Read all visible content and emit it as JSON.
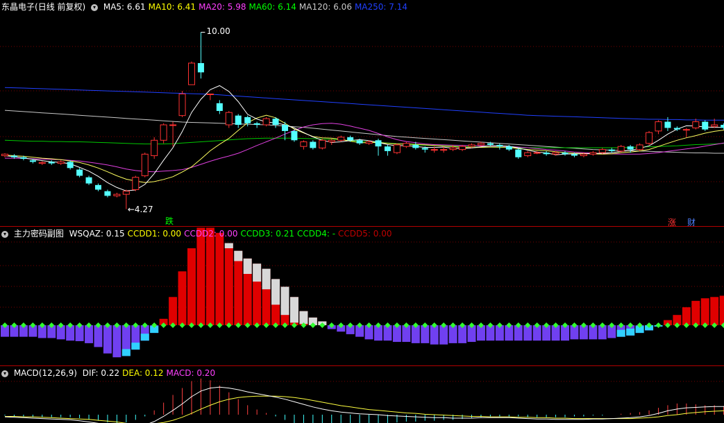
{
  "kline": {
    "stock_name": "东晶电子",
    "period": "(日线 前复权)",
    "menu_icon": "chevron-down-icon",
    "indicators": [
      {
        "label": "MA5: 6.61",
        "color": "#ffffff"
      },
      {
        "label": "MA10: 6.41",
        "color": "#ffff00"
      },
      {
        "label": "MA20: 5.98",
        "color": "#ff40ff"
      },
      {
        "label": "MA60: 6.14",
        "color": "#00ff00"
      },
      {
        "label": "MA120: 6.06",
        "color": "#c8c8c8"
      },
      {
        "label": "MA250: 7.14",
        "color": "#2040ff"
      }
    ],
    "high_marker": "10.00",
    "low_marker": "4.27",
    "badges": {
      "fall": "跌",
      "rise": "涨",
      "finance": "财"
    },
    "colors": {
      "up": "#ff3232",
      "down": "#54ffff"
    }
  },
  "sub1": {
    "title": "主力密码副图",
    "indicators": [
      {
        "label": "WSQAZ: 0.15",
        "color": "#ffffff"
      },
      {
        "label": "CCDD1: 0.00",
        "color": "#ffff00"
      },
      {
        "label": "CCDD2: 0.00",
        "color": "#ff40ff"
      },
      {
        "label": "CCDD3: 0.21",
        "color": "#00ff00"
      },
      {
        "label": "CCDD4: -",
        "color": "#00ff00"
      },
      {
        "label": "CCDD5: 0.00",
        "color": "#c00000"
      }
    ]
  },
  "sub2": {
    "title": "MACD(12,26,9)",
    "indicators": [
      {
        "label": "DIF: 0.22",
        "color": "#ffffff"
      },
      {
        "label": "DEA: 0.12",
        "color": "#ffff00"
      },
      {
        "label": "MACD: 0.20",
        "color": "#ff40ff"
      }
    ]
  },
  "candles": [
    [
      6.0,
      6.05,
      5.95,
      6.08
    ],
    [
      6.0,
      5.95,
      5.9,
      6.05
    ],
    [
      5.95,
      5.9,
      5.85,
      6.0
    ],
    [
      5.85,
      5.8,
      5.75,
      5.9
    ],
    [
      5.75,
      5.78,
      5.7,
      5.82
    ],
    [
      5.8,
      5.75,
      5.7,
      5.85
    ],
    [
      5.75,
      5.8,
      5.7,
      5.85
    ],
    [
      5.8,
      5.6,
      5.55,
      5.85
    ],
    [
      5.55,
      5.35,
      5.3,
      5.6
    ],
    [
      5.3,
      5.1,
      5.05,
      5.35
    ],
    [
      5.05,
      4.9,
      4.85,
      5.1
    ],
    [
      4.85,
      4.7,
      4.65,
      4.9
    ],
    [
      4.7,
      4.75,
      4.65,
      4.8
    ],
    [
      4.75,
      4.85,
      4.27,
      4.9
    ],
    [
      4.9,
      5.3,
      4.85,
      5.35
    ],
    [
      5.35,
      6.05,
      5.3,
      6.1
    ],
    [
      6.0,
      6.5,
      5.9,
      6.6
    ],
    [
      6.5,
      7.0,
      6.4,
      7.05
    ],
    [
      7.0,
      7.0,
      6.3,
      7.1
    ],
    [
      7.3,
      8.0,
      7.25,
      8.1
    ],
    [
      8.3,
      9.0,
      8.3,
      9.05
    ],
    [
      9.0,
      8.7,
      8.5,
      10.0
    ],
    [
      8.0,
      8.0,
      7.8,
      8.0
    ],
    [
      7.7,
      7.45,
      7.35,
      7.8
    ],
    [
      7.0,
      7.4,
      6.9,
      7.45
    ],
    [
      7.3,
      7.0,
      6.9,
      7.35
    ],
    [
      7.25,
      7.05,
      6.95,
      7.3
    ],
    [
      7.05,
      7.0,
      6.9,
      7.1
    ],
    [
      7.0,
      7.2,
      6.95,
      7.25
    ],
    [
      7.2,
      7.0,
      6.9,
      7.25
    ],
    [
      7.0,
      6.8,
      6.5,
      7.1
    ],
    [
      6.8,
      6.5,
      6.45,
      6.85
    ],
    [
      6.3,
      6.45,
      6.2,
      6.5
    ],
    [
      6.45,
      6.25,
      6.2,
      6.5
    ],
    [
      6.25,
      6.5,
      6.2,
      6.55
    ],
    [
      6.45,
      6.5,
      6.35,
      6.55
    ],
    [
      6.5,
      6.6,
      6.45,
      6.65
    ],
    [
      6.6,
      6.5,
      6.45,
      6.65
    ],
    [
      6.5,
      6.4,
      6.35,
      6.55
    ],
    [
      6.4,
      6.45,
      6.35,
      6.5
    ],
    [
      6.5,
      6.3,
      6.0,
      6.55
    ],
    [
      6.3,
      6.15,
      6.0,
      6.35
    ],
    [
      6.1,
      6.35,
      6.05,
      6.4
    ],
    [
      6.3,
      6.4,
      6.25,
      6.45
    ],
    [
      6.35,
      6.25,
      6.2,
      6.45
    ],
    [
      6.25,
      6.2,
      6.1,
      6.3
    ],
    [
      6.2,
      6.2,
      6.1,
      6.3
    ],
    [
      6.2,
      6.2,
      6.1,
      6.3
    ],
    [
      6.2,
      6.25,
      6.15,
      6.35
    ],
    [
      6.2,
      6.3,
      6.15,
      6.35
    ],
    [
      6.3,
      6.35,
      6.25,
      6.4
    ],
    [
      6.35,
      6.4,
      6.3,
      6.45
    ],
    [
      6.4,
      6.35,
      6.3,
      6.45
    ],
    [
      6.35,
      6.3,
      6.2,
      6.4
    ],
    [
      6.3,
      6.2,
      6.15,
      6.35
    ],
    [
      6.2,
      5.95,
      5.9,
      6.25
    ],
    [
      6.0,
      6.1,
      5.95,
      6.15
    ],
    [
      6.1,
      6.1,
      6.05,
      6.15
    ],
    [
      6.1,
      6.05,
      6.0,
      6.15
    ],
    [
      6.05,
      6.1,
      6.0,
      6.15
    ],
    [
      6.1,
      6.05,
      6.0,
      6.15
    ],
    [
      6.05,
      6.0,
      5.95,
      6.1
    ],
    [
      6.0,
      6.05,
      5.95,
      6.1
    ],
    [
      6.05,
      6.1,
      6.0,
      6.15
    ],
    [
      6.1,
      6.2,
      6.05,
      6.25
    ],
    [
      6.2,
      6.15,
      6.1,
      6.25
    ],
    [
      6.15,
      6.3,
      6.1,
      6.35
    ],
    [
      6.3,
      6.2,
      6.1,
      6.35
    ],
    [
      6.2,
      6.35,
      6.15,
      6.4
    ],
    [
      6.4,
      6.75,
      6.35,
      6.8
    ],
    [
      6.8,
      7.1,
      6.7,
      7.15
    ],
    [
      7.1,
      6.9,
      6.8,
      7.25
    ],
    [
      6.9,
      6.85,
      6.8,
      6.95
    ],
    [
      6.85,
      6.85,
      6.6,
      6.9
    ],
    [
      6.9,
      7.1,
      6.85,
      7.2
    ],
    [
      7.1,
      6.85,
      6.8,
      7.15
    ],
    [
      6.95,
      7.0,
      6.9,
      7.2
    ],
    [
      7.0,
      6.9,
      6.85,
      7.05
    ],
    [
      6.8,
      7.0,
      6.75,
      7.1
    ],
    [
      6.9,
      6.85,
      6.8,
      7.05
    ],
    [
      6.85,
      7.1,
      6.75,
      7.15
    ]
  ],
  "ma_series": {
    "ma5": [
      6.0,
      5.97,
      5.93,
      5.88,
      5.84,
      5.8,
      5.78,
      5.74,
      5.62,
      5.5,
      5.33,
      5.13,
      4.97,
      4.86,
      4.89,
      5.07,
      5.42,
      5.85,
      6.26,
      6.78,
      7.4,
      7.83,
      8.14,
      8.27,
      8.08,
      7.75,
      7.34,
      7.19,
      7.09,
      7.06,
      7.0,
      6.9,
      6.75,
      6.61,
      6.5,
      6.43,
      6.45,
      6.49,
      6.52,
      6.49,
      6.43,
      6.36,
      6.32,
      6.33,
      6.3,
      6.27,
      6.27,
      6.28,
      6.24,
      6.23,
      6.25,
      6.29,
      6.32,
      6.32,
      6.31,
      6.25,
      6.18,
      6.12,
      6.09,
      6.03,
      6.05,
      6.06,
      6.06,
      6.07,
      6.08,
      6.1,
      6.14,
      6.17,
      6.24,
      6.32,
      6.5,
      6.7,
      6.86,
      6.97,
      6.96,
      6.93,
      6.92,
      6.92,
      6.97,
      6.92,
      6.94
    ],
    "ma10": [
      6.02,
      6.0,
      5.98,
      5.95,
      5.92,
      5.9,
      5.87,
      5.83,
      5.78,
      5.7,
      5.6,
      5.48,
      5.35,
      5.24,
      5.18,
      5.13,
      5.16,
      5.23,
      5.32,
      5.47,
      5.64,
      5.89,
      6.16,
      6.37,
      6.56,
      6.82,
      7.07,
      7.22,
      7.31,
      7.23,
      7.05,
      6.86,
      6.74,
      6.62,
      6.58,
      6.57,
      6.53,
      6.47,
      6.42,
      6.42,
      6.43,
      6.4,
      6.38,
      6.38,
      6.37,
      6.35,
      6.33,
      6.31,
      6.3,
      6.27,
      6.26,
      6.27,
      6.28,
      6.28,
      6.27,
      6.23,
      6.2,
      6.18,
      6.16,
      6.13,
      6.1,
      6.08,
      6.07,
      6.06,
      6.05,
      6.06,
      6.1,
      6.12,
      6.15,
      6.2,
      6.3,
      6.4,
      6.5,
      6.58,
      6.65,
      6.73,
      6.79,
      6.83,
      6.86,
      6.88,
      6.9
    ],
    "ma20": [
      5.92,
      5.92,
      5.91,
      5.9,
      5.89,
      5.88,
      5.87,
      5.85,
      5.83,
      5.79,
      5.75,
      5.7,
      5.64,
      5.57,
      5.52,
      5.49,
      5.48,
      5.5,
      5.52,
      5.55,
      5.62,
      5.72,
      5.82,
      5.91,
      5.99,
      6.08,
      6.2,
      6.33,
      6.45,
      6.57,
      6.7,
      6.82,
      6.93,
      7.0,
      7.04,
      7.05,
      7.02,
      6.96,
      6.89,
      6.82,
      6.72,
      6.61,
      6.52,
      6.46,
      6.42,
      6.38,
      6.36,
      6.35,
      6.34,
      6.33,
      6.32,
      6.32,
      6.31,
      6.31,
      6.3,
      6.28,
      6.26,
      6.23,
      6.2,
      6.18,
      6.15,
      6.12,
      6.1,
      6.08,
      6.07,
      6.06,
      6.05,
      6.05,
      6.05,
      6.07,
      6.1,
      6.14,
      6.18,
      6.22,
      6.26,
      6.31,
      6.36,
      6.41,
      6.45,
      6.49,
      6.53
    ],
    "ma60": [
      6.5,
      6.49,
      6.48,
      6.47,
      6.47,
      6.46,
      6.46,
      6.45,
      6.45,
      6.44,
      6.43,
      6.42,
      6.41,
      6.4,
      6.39,
      6.38,
      6.38,
      6.38,
      6.39,
      6.41,
      6.43,
      6.45,
      6.47,
      6.49,
      6.51,
      6.53,
      6.55,
      6.56,
      6.57,
      6.57,
      6.57,
      6.57,
      6.56,
      6.55,
      6.54,
      6.53,
      6.51,
      6.49,
      6.47,
      6.45,
      6.43,
      6.41,
      6.39,
      6.37,
      6.35,
      6.34,
      6.33,
      6.32,
      6.31,
      6.3,
      6.29,
      6.28,
      6.28,
      6.27,
      6.27,
      6.26,
      6.26,
      6.26,
      6.26,
      6.26,
      6.26,
      6.26,
      6.26,
      6.26,
      6.26,
      6.26,
      6.26,
      6.27,
      6.28,
      6.29,
      6.3,
      6.31,
      6.32,
      6.34,
      6.36,
      6.37,
      6.38,
      6.4,
      6.42,
      6.43,
      6.45
    ],
    "ma120": [
      7.47,
      7.45,
      7.43,
      7.41,
      7.39,
      7.37,
      7.35,
      7.33,
      7.31,
      7.29,
      7.27,
      7.25,
      7.23,
      7.21,
      7.19,
      7.17,
      7.15,
      7.13,
      7.11,
      7.09,
      7.08,
      7.07,
      7.06,
      7.05,
      7.04,
      7.03,
      7.02,
      7.01,
      7.0,
      6.98,
      6.96,
      6.94,
      6.92,
      6.89,
      6.86,
      6.83,
      6.8,
      6.77,
      6.74,
      6.71,
      6.68,
      6.65,
      6.62,
      6.6,
      6.58,
      6.56,
      6.54,
      6.52,
      6.5,
      6.48,
      6.46,
      6.44,
      6.42,
      6.4,
      6.38,
      6.36,
      6.34,
      6.32,
      6.3,
      6.28,
      6.26,
      6.24,
      6.22,
      6.2,
      6.19,
      6.18,
      6.17,
      6.16,
      6.15,
      6.14,
      6.13,
      6.12,
      6.11,
      6.1,
      6.09,
      6.09,
      6.08,
      6.08,
      6.07,
      6.07,
      6.06
    ],
    "ma250": [
      8.21,
      8.2,
      8.19,
      8.18,
      8.17,
      8.16,
      8.15,
      8.14,
      8.13,
      8.12,
      8.11,
      8.1,
      8.09,
      8.08,
      8.07,
      8.06,
      8.05,
      8.04,
      8.03,
      8.02,
      8.01,
      8.0,
      7.99,
      7.97,
      7.95,
      7.93,
      7.91,
      7.89,
      7.87,
      7.85,
      7.83,
      7.81,
      7.79,
      7.77,
      7.75,
      7.73,
      7.71,
      7.69,
      7.67,
      7.65,
      7.63,
      7.61,
      7.59,
      7.57,
      7.55,
      7.53,
      7.51,
      7.49,
      7.47,
      7.45,
      7.43,
      7.41,
      7.39,
      7.37,
      7.35,
      7.33,
      7.31,
      7.3,
      7.29,
      7.28,
      7.27,
      7.26,
      7.25,
      7.24,
      7.23,
      7.22,
      7.21,
      7.2,
      7.19,
      7.18,
      7.18,
      7.17,
      7.17,
      7.16,
      7.16,
      7.15,
      7.15,
      7.15,
      7.14,
      7.14,
      7.14
    ]
  },
  "sub1_bars": [
    -0.45,
    -0.45,
    -0.45,
    -0.45,
    -0.5,
    -0.5,
    -0.55,
    -0.6,
    -0.62,
    -0.7,
    -0.85,
    -1.1,
    -1.25,
    -1.2,
    -0.95,
    -0.6,
    -0.3,
    0.25,
    1.1,
    2.1,
    3.0,
    3.8,
    3.8,
    3.6,
    3.2,
    2.9,
    2.6,
    2.4,
    2.2,
    1.8,
    1.5,
    1.1,
    0.55,
    0.3,
    0.15,
    -0.15,
    -0.25,
    -0.35,
    -0.45,
    -0.55,
    -0.6,
    -0.6,
    -0.65,
    -0.65,
    -0.7,
    -0.7,
    -0.75,
    -0.75,
    -0.7,
    -0.7,
    -0.65,
    -0.6,
    -0.6,
    -0.6,
    -0.6,
    -0.6,
    -0.6,
    -0.6,
    -0.6,
    -0.6,
    -0.6,
    -0.55,
    -0.55,
    -0.55,
    -0.55,
    -0.5,
    -0.45,
    -0.4,
    -0.3,
    -0.2,
    -0.05,
    0.2,
    0.4,
    0.7,
    0.95,
    1.05,
    1.1,
    1.15,
    1.3
  ],
  "sub1_white_top": [
    0,
    0,
    0,
    0,
    0,
    0,
    0,
    0,
    0,
    0,
    0,
    0,
    0,
    0,
    0,
    0,
    0,
    0,
    0,
    0,
    0,
    0,
    0,
    0,
    0.2,
    0.4,
    0.6,
    0.7,
    0.8,
    1.0,
    1.1,
    1.0,
    0.5,
    0.3,
    0.15,
    0,
    0,
    0,
    0,
    0,
    0,
    0,
    0,
    0,
    0,
    0,
    0,
    0,
    0,
    0,
    0,
    0,
    0,
    0,
    0,
    0,
    0,
    0,
    0,
    0,
    0,
    0,
    0,
    0,
    0,
    0,
    0,
    0,
    0,
    0,
    0,
    0,
    0,
    0,
    0,
    0,
    0,
    0,
    0,
    0,
    0
  ],
  "macd_dif": [
    -0.05,
    -0.06,
    -0.07,
    -0.08,
    -0.09,
    -0.1,
    -0.11,
    -0.12,
    -0.14,
    -0.17,
    -0.2,
    -0.24,
    -0.27,
    -0.29,
    -0.28,
    -0.24,
    -0.16,
    -0.04,
    0.1,
    0.25,
    0.42,
    0.55,
    0.62,
    0.64,
    0.62,
    0.58,
    0.53,
    0.49,
    0.45,
    0.41,
    0.36,
    0.3,
    0.24,
    0.18,
    0.13,
    0.09,
    0.06,
    0.04,
    0.02,
    0.01,
    0.0,
    -0.02,
    -0.03,
    -0.04,
    -0.05,
    -0.06,
    -0.07,
    -0.07,
    -0.08,
    -0.08,
    -0.08,
    -0.07,
    -0.07,
    -0.07,
    -0.07,
    -0.08,
    -0.09,
    -0.1,
    -0.1,
    -0.11,
    -0.11,
    -0.11,
    -0.11,
    -0.1,
    -0.1,
    -0.09,
    -0.08,
    -0.07,
    -0.05,
    -0.02,
    0.03,
    0.09,
    0.13,
    0.16,
    0.17,
    0.18,
    0.19,
    0.19,
    0.2,
    0.21,
    0.22
  ],
  "macd_dea": [
    -0.04,
    -0.04,
    -0.05,
    -0.05,
    -0.06,
    -0.07,
    -0.08,
    -0.09,
    -0.1,
    -0.11,
    -0.13,
    -0.15,
    -0.17,
    -0.2,
    -0.22,
    -0.22,
    -0.21,
    -0.18,
    -0.13,
    -0.06,
    0.03,
    0.13,
    0.22,
    0.3,
    0.36,
    0.4,
    0.42,
    0.43,
    0.43,
    0.43,
    0.42,
    0.4,
    0.37,
    0.33,
    0.29,
    0.25,
    0.21,
    0.18,
    0.15,
    0.12,
    0.1,
    0.08,
    0.06,
    0.04,
    0.03,
    0.01,
    0.0,
    -0.01,
    -0.02,
    -0.03,
    -0.04,
    -0.04,
    -0.05,
    -0.05,
    -0.05,
    -0.06,
    -0.06,
    -0.07,
    -0.07,
    -0.08,
    -0.08,
    -0.09,
    -0.09,
    -0.09,
    -0.09,
    -0.09,
    -0.09,
    -0.09,
    -0.08,
    -0.07,
    -0.05,
    -0.02,
    0.0,
    0.03,
    0.05,
    0.07,
    0.08,
    0.09,
    0.1,
    0.11,
    0.12
  ]
}
